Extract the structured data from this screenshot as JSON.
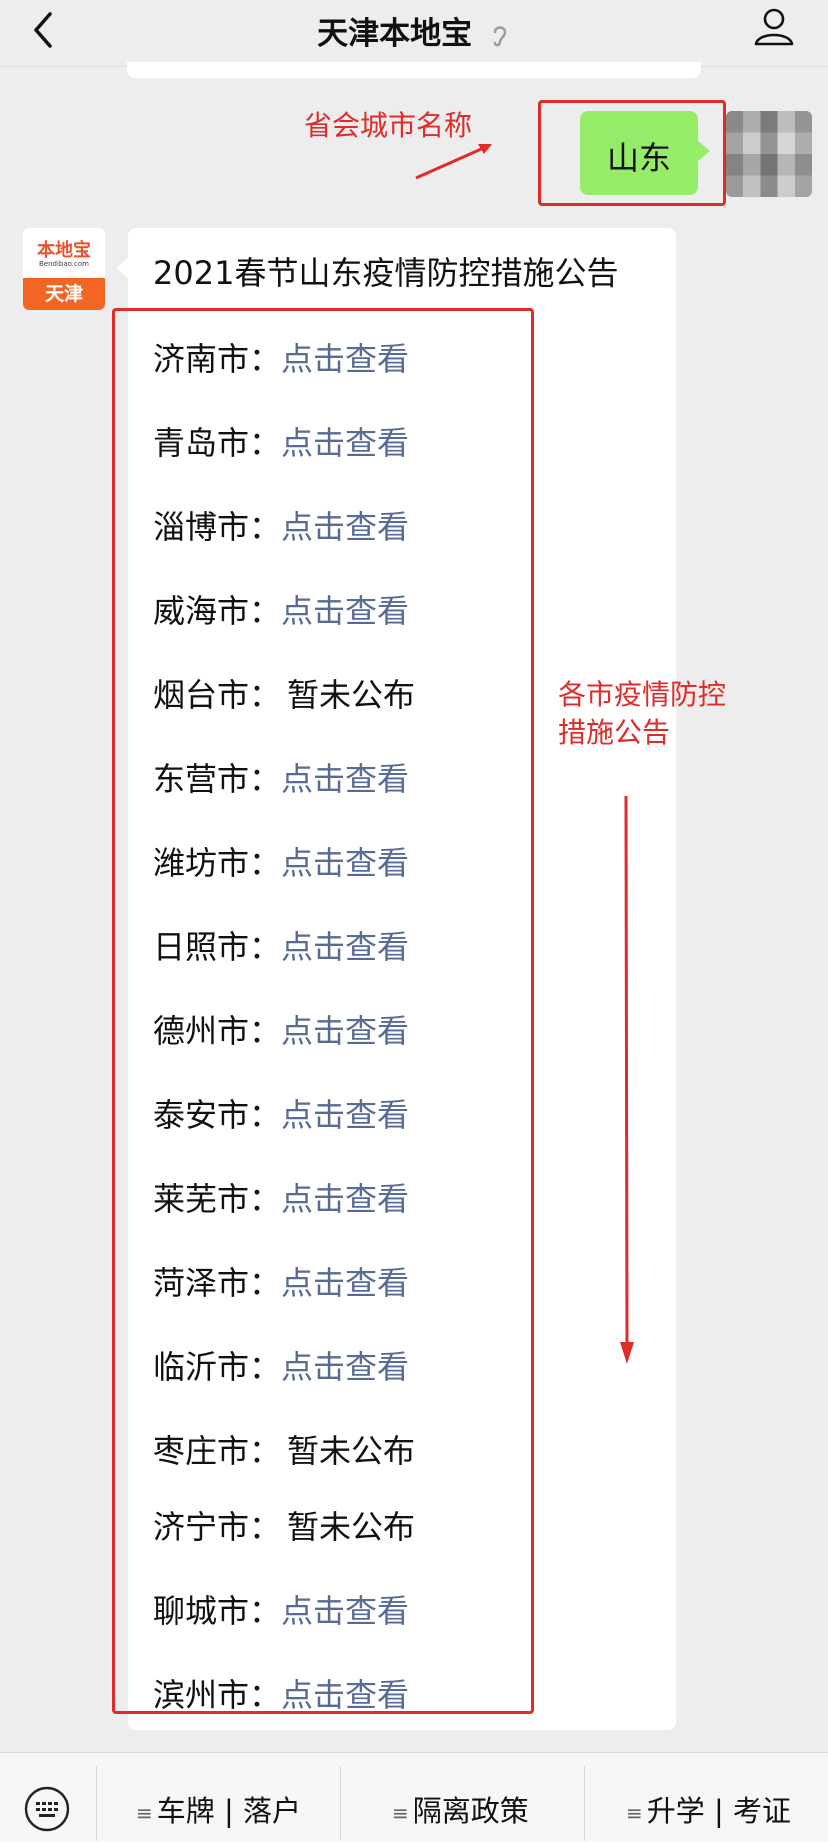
{
  "header": {
    "title": "天津本地宝"
  },
  "chat": {
    "sent_message": "山东",
    "received_logo": {
      "brand": "本地宝",
      "sub": "Bendibao.com",
      "city": "天津"
    },
    "received_title": "2021春节山东疫情防控措施公告",
    "cities": [
      {
        "name": "济南市：",
        "link": "点击查看",
        "status": ""
      },
      {
        "name": "青岛市：",
        "link": "点击查看",
        "status": ""
      },
      {
        "name": "淄博市：",
        "link": "点击查看",
        "status": ""
      },
      {
        "name": "威海市：",
        "link": "点击查看",
        "status": ""
      },
      {
        "name": "烟台市：",
        "link": "",
        "status": "暂未公布"
      },
      {
        "name": "东营市：",
        "link": "点击查看",
        "status": ""
      },
      {
        "name": "潍坊市：",
        "link": "点击查看",
        "status": ""
      },
      {
        "name": "日照市：",
        "link": "点击查看",
        "status": ""
      },
      {
        "name": "德州市：",
        "link": "点击查看",
        "status": ""
      },
      {
        "name": "泰安市：",
        "link": "点击查看",
        "status": ""
      },
      {
        "name": "莱芜市：",
        "link": "点击查看",
        "status": ""
      },
      {
        "name": "菏泽市：",
        "link": "点击查看",
        "status": ""
      },
      {
        "name": "临沂市：",
        "link": "点击查看",
        "status": ""
      },
      {
        "name": "枣庄市：",
        "link": "",
        "status": "暂未公布"
      },
      {
        "name": "济宁市：",
        "link": "",
        "status": "暂未公布"
      },
      {
        "name": "聊城市：",
        "link": "点击查看",
        "status": ""
      },
      {
        "name": "滨州市：",
        "link": "点击查看",
        "status": ""
      }
    ]
  },
  "annotations": {
    "province_label": "省会城市名称",
    "list_label_line1": "各市疫情防控",
    "list_label_line2": "措施公告"
  },
  "menu": {
    "items": [
      {
        "label": "车牌 | 落户"
      },
      {
        "label": "隔离政策"
      },
      {
        "label": "升学 | 考证"
      }
    ]
  },
  "colors": {
    "link": "#576b95",
    "annotation": "#e02b2b",
    "sent_bubble": "#95ec69"
  }
}
